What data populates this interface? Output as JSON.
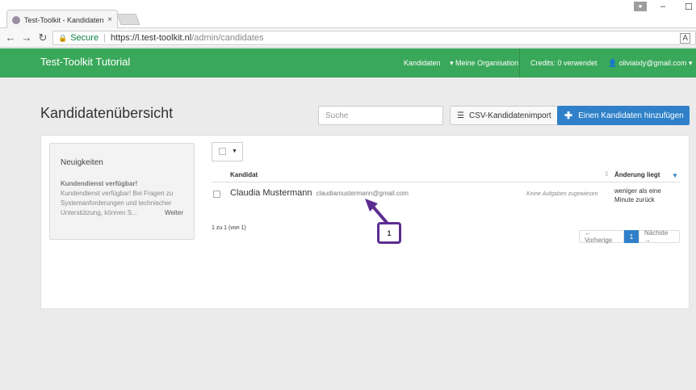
{
  "browser": {
    "tab_title": "Test-Toolkit - Kandidaten",
    "tab_close": "×",
    "secure_label": "Secure",
    "url_host": "https://l.test-toolkit.nl",
    "url_path": "/admin/candidates",
    "translate_icon": "translate-icon"
  },
  "navbar": {
    "brand": "Test-Toolkit Tutorial",
    "kandidaten": "Kandidaten",
    "organisation": "Meine Organisation",
    "credits": "Credits: 0 verwendet",
    "user_email": "oliviaixly@gmail.com",
    "color": "#3aa85a"
  },
  "page": {
    "title": "Kandidatenübersicht",
    "search_placeholder": "Suche",
    "import_label": "CSV-Kandidatenimport",
    "add_label": "Einen Kandidaten hinzufügen",
    "accent": "#2f80c9"
  },
  "news": {
    "title": "Neuigkeiten",
    "headline": "Kundendienst verfügbar!",
    "text": "Kundendienst verfügbar! Bei Fragen zu Systemanforderungen und technischer Unterstützung, können S...",
    "more": "Weiter"
  },
  "table": {
    "columns": [
      "Kandidat",
      "Änderung liegt"
    ],
    "rows": [
      {
        "name": "Claudia Mustermann",
        "email": "claudiamustermann@gmail.com",
        "tasks": "Keine Aufgaben zugewiesen",
        "change": "weniger als eine Minute zurück"
      }
    ]
  },
  "pagination": {
    "info": "1 zu 1 (von 1)",
    "prev": "← Vorherige",
    "current": "1",
    "next": "Nächste →"
  },
  "annotation": {
    "label": "1",
    "color": "#5c2d91"
  }
}
